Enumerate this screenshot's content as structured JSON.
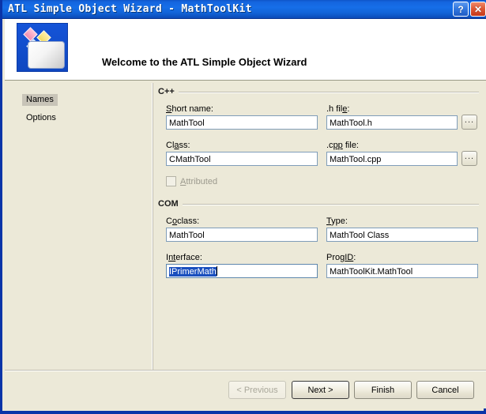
{
  "window": {
    "title": "ATL Simple Object Wizard - MathToolKit",
    "help_button": "?",
    "close_button": "✕"
  },
  "banner": {
    "heading": "Welcome to the ATL Simple Object Wizard",
    "icon": "wizard-document-icon"
  },
  "nav": {
    "items": [
      {
        "label": "Names",
        "selected": true
      },
      {
        "label": "Options",
        "selected": false
      }
    ]
  },
  "groups": {
    "cpp": {
      "legend": "C++",
      "fields": {
        "short_name": {
          "label_pre": "",
          "label_acc": "S",
          "label_post": "hort name:",
          "value": "MathTool"
        },
        "h_file": {
          "label_pre": ".h fil",
          "label_acc": "e",
          "label_post": ":",
          "value": "MathTool.h",
          "browse": "..."
        },
        "class": {
          "label_pre": "Cl",
          "label_acc": "a",
          "label_post": "ss:",
          "value": "CMathTool"
        },
        "cpp_file": {
          "label_pre": ".c",
          "label_acc": "pp",
          "label_post": " file:",
          "value": "MathTool.cpp",
          "browse": "..."
        }
      },
      "attributed": {
        "label_pre": "",
        "label_acc": "A",
        "label_post": "ttributed",
        "checked": false,
        "disabled": true
      }
    },
    "com": {
      "legend": "COM",
      "fields": {
        "coclass": {
          "label_pre": "C",
          "label_acc": "o",
          "label_post": "class:",
          "value": "MathTool"
        },
        "type": {
          "label_pre": "",
          "label_acc": "T",
          "label_post": "ype:",
          "value": "MathTool Class"
        },
        "interface": {
          "label_pre": "I",
          "label_acc": "nt",
          "label_post": "erface:",
          "value": "IPrimerMath",
          "focused": true,
          "selected": true
        },
        "progid": {
          "label_pre": "Prog",
          "label_acc": "ID",
          "label_post": ":",
          "value": "MathToolKit.MathTool"
        }
      }
    }
  },
  "footer": {
    "previous": "< Previous",
    "next": "Next >",
    "finish": "Finish",
    "cancel": "Cancel"
  },
  "colors": {
    "titlebar_blue": "#1464de",
    "window_face": "#ece9d8",
    "selection_blue": "#1a4fbe",
    "textbox_border": "#7f9db9"
  }
}
